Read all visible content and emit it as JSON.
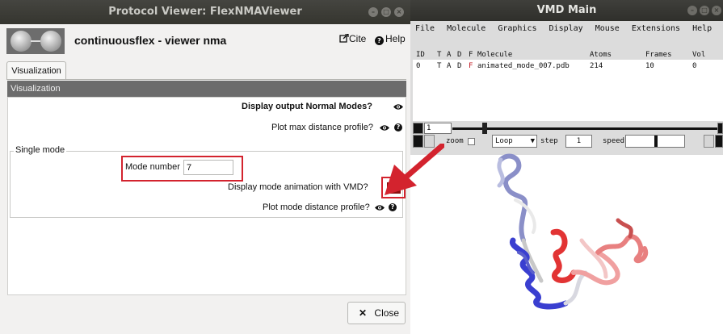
{
  "protocol_viewer": {
    "title": "Protocol Viewer: FlexNMAViewer",
    "app_name": "continuousflex - viewer nma",
    "cite_label": "Cite",
    "help_label": "Help",
    "tab_label": "Visualization",
    "section_title": "Visualization",
    "display_modes_label": "Display output Normal Modes?",
    "plot_max_distance_label": "Plot max distance profile?",
    "group_title": "Single mode",
    "mode_number_label": "Mode number",
    "mode_number_value": "7",
    "display_animation_label": "Display mode animation with VMD?",
    "plot_mode_distance_label": "Plot mode distance profile?",
    "close_label": "Close"
  },
  "vmd": {
    "title": "VMD Main",
    "menu": [
      "File",
      "Molecule",
      "Graphics",
      "Display",
      "Mouse",
      "Extensions",
      "Help"
    ],
    "columns": {
      "id": "ID",
      "t": "T",
      "a": "A",
      "d": "D",
      "f": "F",
      "molecule": "Molecule",
      "atoms": "Atoms",
      "frames": "Frames",
      "vol": "Vol"
    },
    "row": {
      "id": "0",
      "t": "T",
      "a": "A",
      "d": "D",
      "f": "F",
      "molecule": "animated_mode_007.pdb",
      "atoms": "214",
      "frames": "10",
      "vol": "0"
    },
    "frame_value": "1",
    "zoom_label": "zoom",
    "loop_value": "Loop",
    "step_label": "step",
    "step_value": "1",
    "speed_label": "speed"
  },
  "colors": {
    "highlight": "#d3232e",
    "animation_button": "#8c1010",
    "section_bar": "#6c6c6c"
  }
}
